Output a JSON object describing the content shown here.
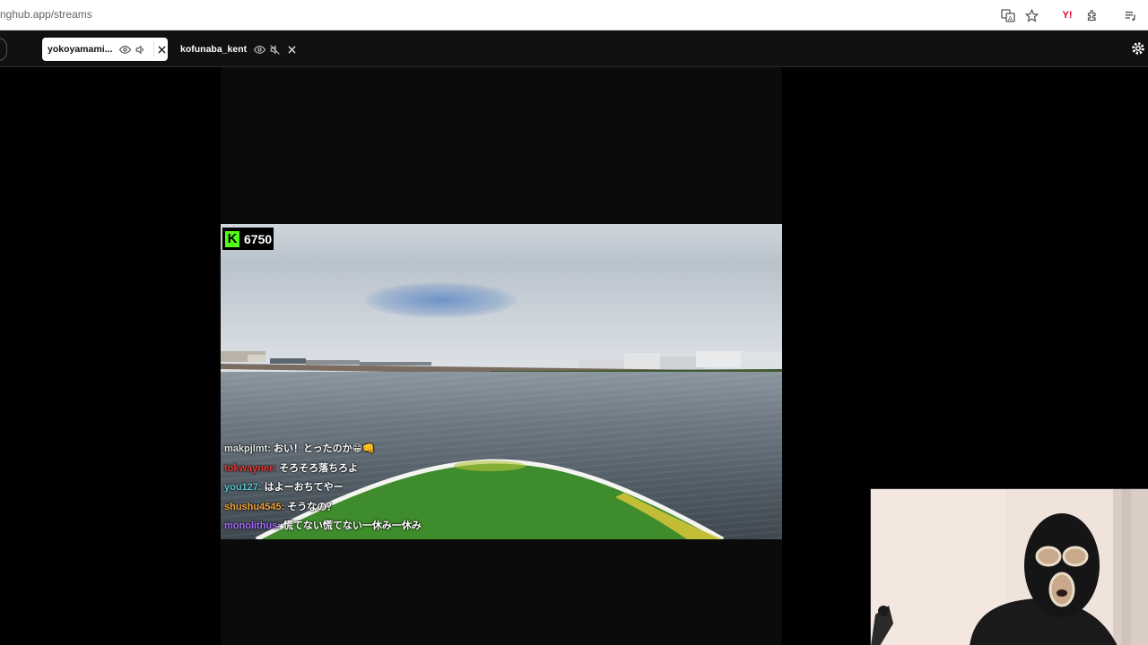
{
  "browser": {
    "url": "nghub.app/streams",
    "icons": [
      "translate-icon",
      "star-icon",
      "yahoo-icon",
      "extensions-icon",
      "queue-icon"
    ]
  },
  "tabs": [
    {
      "name": "yokoyamami...",
      "active": true
    },
    {
      "name": "kofunaba_kent",
      "active": false
    }
  ],
  "stream": {
    "platform_badge": "K",
    "viewer_count": "6750",
    "chat": [
      {
        "user": "makpjlmt:",
        "user_color": "#dfe8e0",
        "message": "おい！とったのか😁👊"
      },
      {
        "user": "tokwayner:",
        "user_color": "#e33b3b",
        "message": "そろそろ落ちろよ"
      },
      {
        "user": "you127:",
        "user_color": "#5fc7cf",
        "message": "はよーおちてやー"
      },
      {
        "user": "shushu4545:",
        "user_color": "#f0a33c",
        "message": "そうなの？"
      },
      {
        "user": "monolithus:",
        "user_color": "#a46fff",
        "message": "慌てない慌てない一休み一休み"
      }
    ]
  },
  "colors": {
    "kick_green": "#53fc18",
    "background": "#000000"
  }
}
